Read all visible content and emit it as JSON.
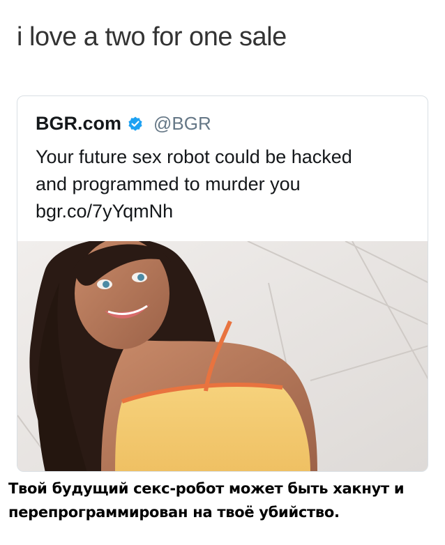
{
  "caption": "i love a two for one sale",
  "tweet": {
    "author_name": "BGR.com",
    "verified_icon": "verified-badge-icon",
    "handle": "@BGR",
    "text_line1": "Your future sex robot could be hacked",
    "text_line2": "and programmed to murder you",
    "link": "bgr.co/7yYqmNh"
  },
  "footer": {
    "line1": "Твой будущий секс-робот может быть хакнут и",
    "line2": "перепрограммирован на твоё убийство."
  },
  "colors": {
    "verified_blue": "#1da1f2",
    "handle_gray": "#657786",
    "card_border": "#d9dfe4"
  }
}
